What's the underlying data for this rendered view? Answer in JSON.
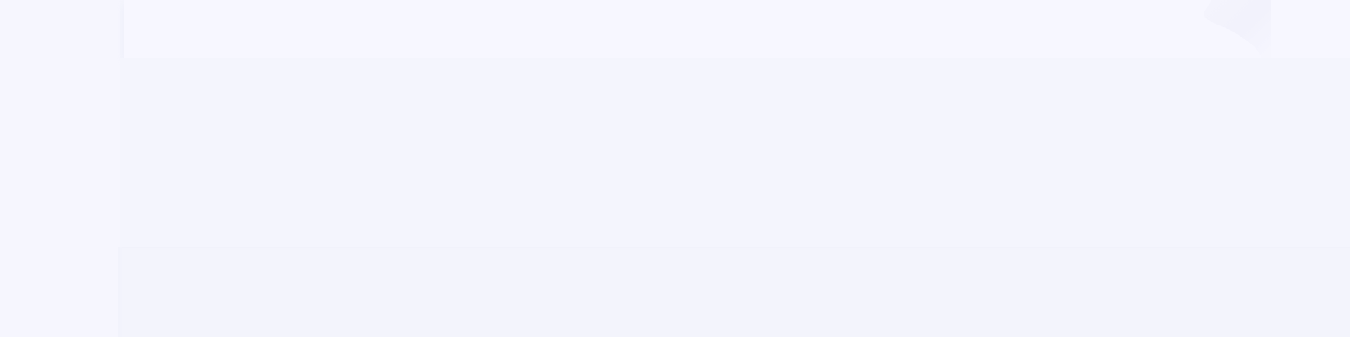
{
  "page": {
    "title": "",
    "status": ""
  },
  "colors": {
    "background": "#f4f5fd",
    "sidebar": "#f6f6fe",
    "banner": "#f7f7ff",
    "lower_panel": "#f3f4fc"
  }
}
